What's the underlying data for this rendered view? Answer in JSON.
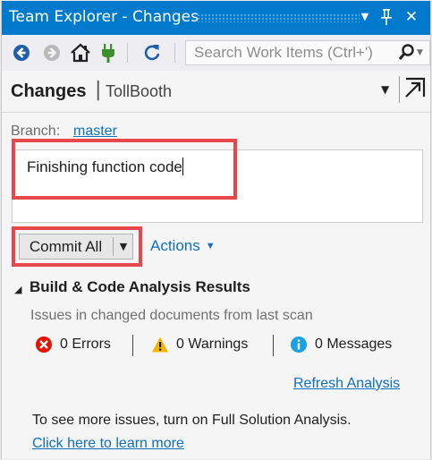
{
  "window": {
    "title": "Team Explorer - Changes",
    "controls": {
      "dropdown_icon": "chevron-down-icon",
      "pin_icon": "pin-icon",
      "close_icon": "close-icon",
      "dropdown_glyph": "▼",
      "pin_glyph": "ᛘ",
      "close_glyph": "✕"
    }
  },
  "toolbar": {
    "buttons": [
      {
        "icon": "back-icon"
      },
      {
        "icon": "forward-icon"
      },
      {
        "icon": "home-icon"
      },
      {
        "icon": "connect-icon"
      },
      {
        "icon": "refresh-icon"
      }
    ],
    "search": {
      "placeholder": "Search Work Items (Ctrl+')",
      "icon": "search-icon"
    }
  },
  "header": {
    "title": "Changes",
    "separator": "|",
    "repo": "TollBooth",
    "dropdown_glyph": "▼"
  },
  "branch": {
    "label": "Branch:",
    "name": "master"
  },
  "commit": {
    "message": "Finishing function code",
    "button_label": "Commit All",
    "dropdown_glyph": "▼",
    "actions_label": "Actions",
    "actions_caret": "▼"
  },
  "build_analysis": {
    "toggle_glyph": "◢",
    "title": "Build & Code Analysis Results",
    "subtitle": "Issues in changed documents from last scan",
    "errors": "0 Errors",
    "warnings": "0 Warnings",
    "messages": "0 Messages",
    "refresh_label": "Refresh Analysis",
    "info_text": "To see more issues, turn on Full Solution Analysis.",
    "learn_more_label": "Click here to learn more"
  },
  "colors": {
    "accent": "#007acc",
    "link": "#0e70c0",
    "highlight": "#e8474b",
    "error": "#e51400",
    "warning": "#f2b600",
    "info": "#1ba1e2"
  }
}
